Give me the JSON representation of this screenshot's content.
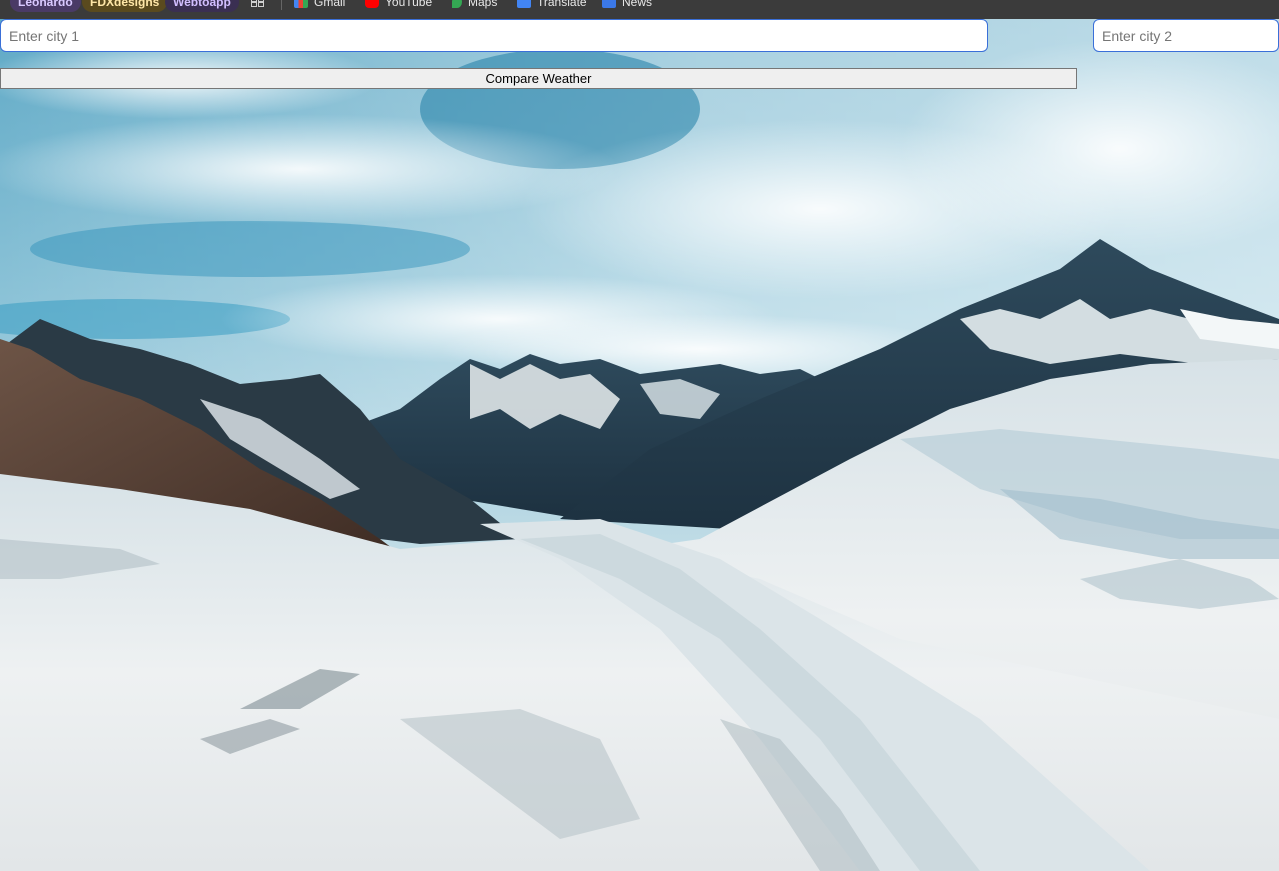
{
  "bookmarks": [
    {
      "label": "Leonardo",
      "icon": "leonardo-icon"
    },
    {
      "label": "FDXdesigns",
      "icon": "fdxdesigns-icon"
    },
    {
      "label": "Webtoapp",
      "icon": "webtoapp-icon"
    },
    {
      "label": "Gmail",
      "icon": "gmail-icon"
    },
    {
      "label": "YouTube",
      "icon": "youtube-icon"
    },
    {
      "label": "Maps",
      "icon": "maps-icon"
    },
    {
      "label": "Translate",
      "icon": "translate-icon"
    },
    {
      "label": "News",
      "icon": "news-icon"
    }
  ],
  "form": {
    "city1": {
      "placeholder": "Enter city 1",
      "value": ""
    },
    "city2": {
      "placeholder": "Enter city 2",
      "value": ""
    },
    "compare_label": "Compare Weather"
  },
  "background": {
    "subject": "snowy-mountain-glacier-landscape"
  },
  "colors": {
    "input_border": "#3a6fd8",
    "bookmark_bar": "#3b3b3b",
    "button_bg": "#efefef"
  }
}
